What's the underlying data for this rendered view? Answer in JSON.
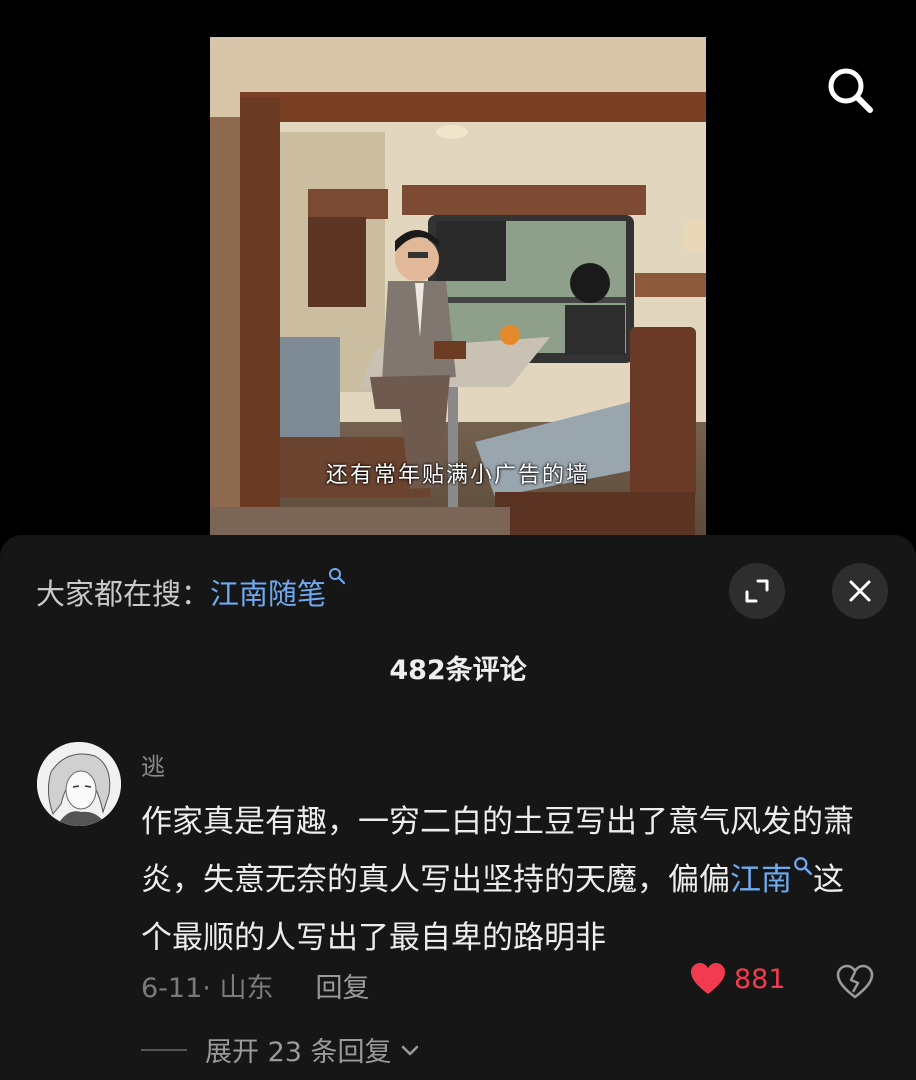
{
  "video": {
    "subtitle": "还有常年贴满小广告的墙"
  },
  "trending": {
    "prefix": "大家都在搜：",
    "keyword": "江南随笔"
  },
  "comments_header": {
    "title": "482条评论"
  },
  "comment": {
    "username": "逃",
    "text_part1": "作家真是有趣，一穷二白的土豆写出了意气风发的萧炎，失意无奈的真人写出坚持的天魔，偏偏",
    "link": "江南",
    "text_part2": "这个最顺的人写出了最自卑的路明非",
    "date_location": "6-11· 山东",
    "reply_label": "回复",
    "like_count": "881",
    "expand_label": "展开 23 条回复"
  },
  "colors": {
    "link": "#6fa9ef",
    "like": "#f23b4f",
    "panel_bg": "#161616"
  },
  "icons": [
    "search-icon",
    "expand-icon",
    "close-icon",
    "heart-icon",
    "broken-heart-icon",
    "chevron-down-icon"
  ]
}
